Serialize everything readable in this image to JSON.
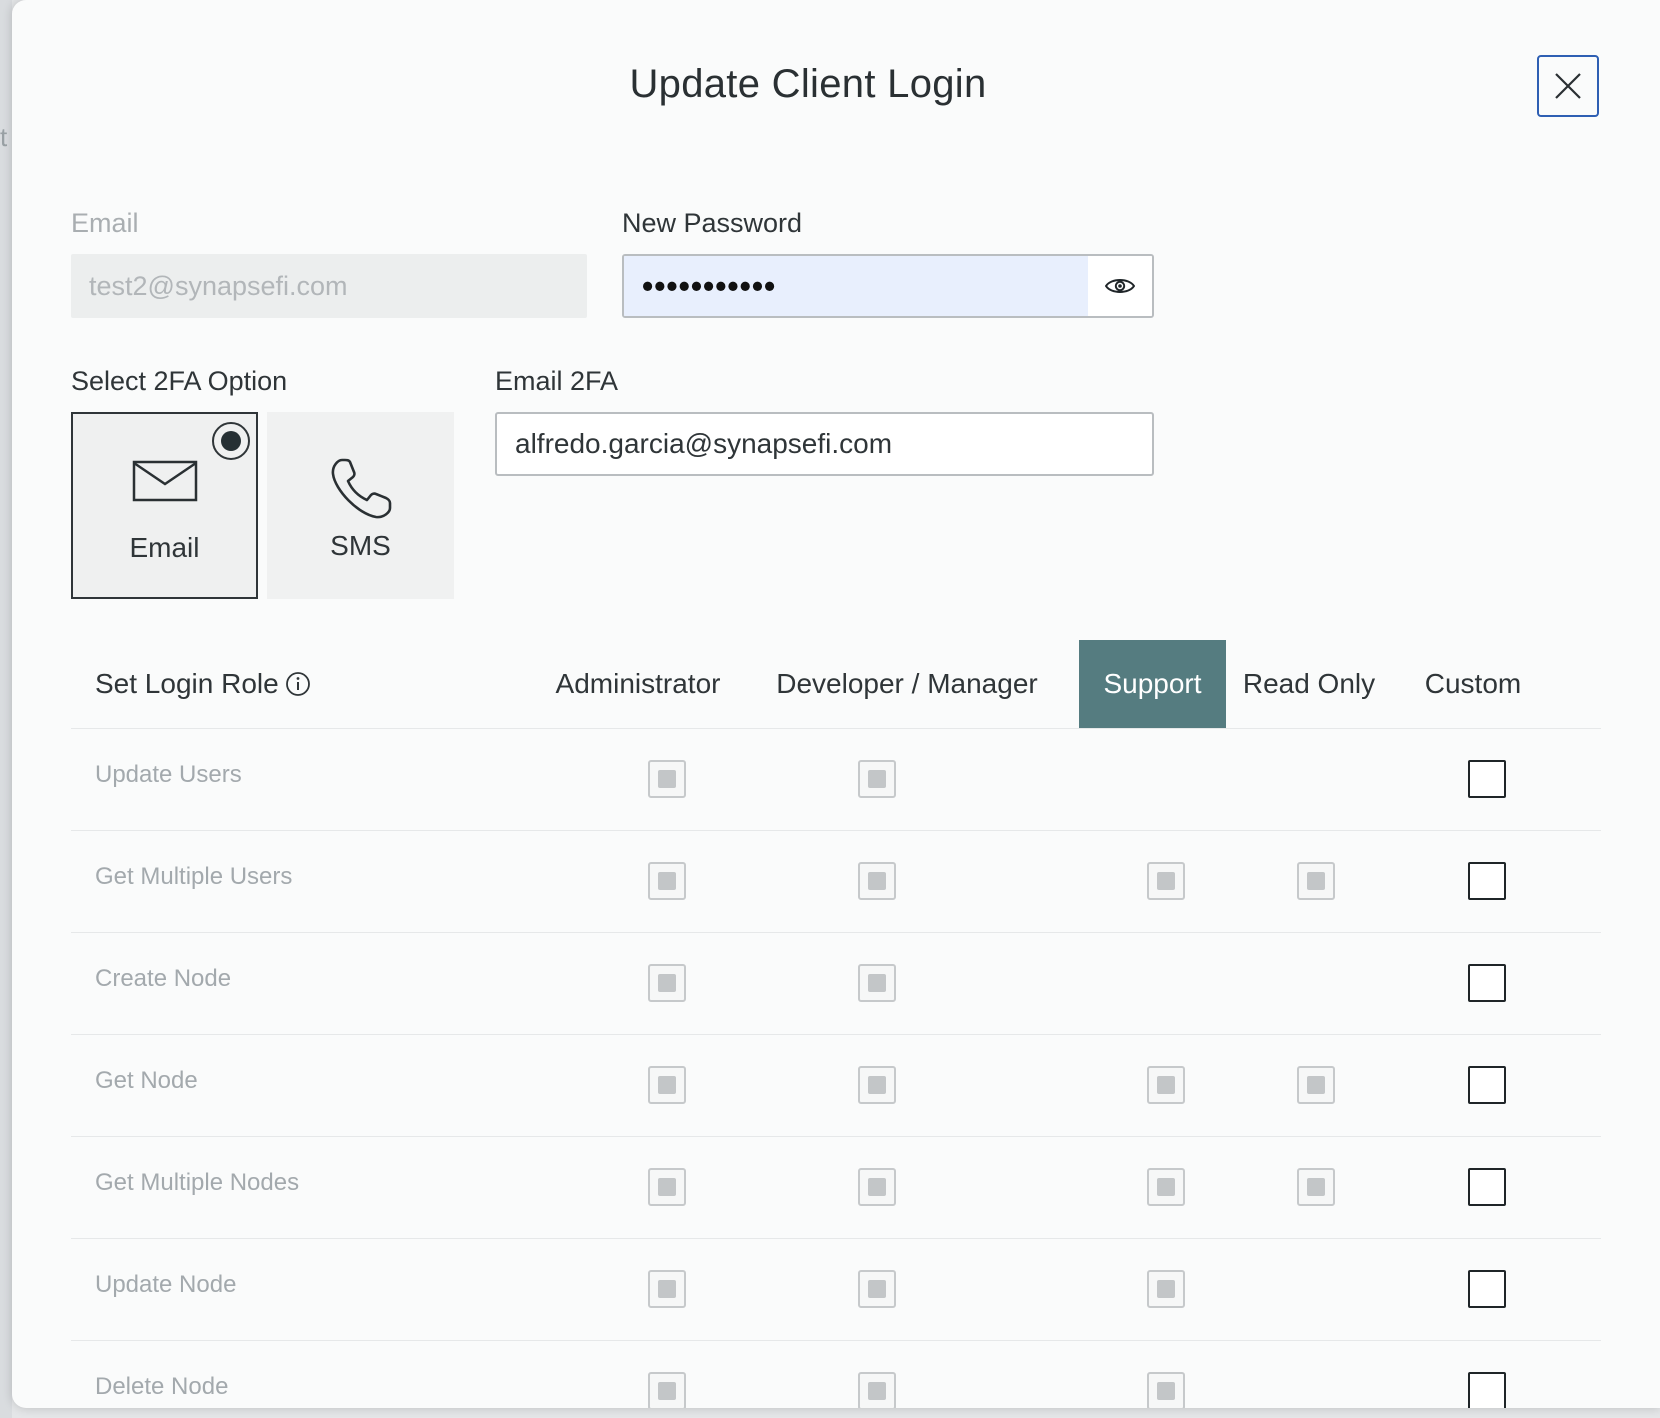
{
  "modal": {
    "title": "Update Client Login"
  },
  "form": {
    "email_label": "Email",
    "email_value": "test2@synapsefi.com",
    "password_label": "New Password",
    "password_masked": "•••••••••••",
    "twofa_label": "Select 2FA Option",
    "twofa_options": [
      {
        "label": "Email",
        "icon": "envelope-icon",
        "selected": true
      },
      {
        "label": "SMS",
        "icon": "phone-icon",
        "selected": false
      }
    ],
    "email2fa_label": "Email 2FA",
    "email2fa_value": "alfredo.garcia@synapsefi.com"
  },
  "roles": {
    "header_label": "Set Login Role",
    "columns": [
      "Administrator",
      "Developer / Manager",
      "Support",
      "Read Only",
      "Custom"
    ],
    "active_column": "Support",
    "permissions": [
      {
        "label": "Update Users",
        "checks": [
          true,
          true,
          false,
          false,
          false
        ]
      },
      {
        "label": "Get Multiple Users",
        "checks": [
          true,
          true,
          true,
          true,
          false
        ]
      },
      {
        "label": "Create Node",
        "checks": [
          true,
          true,
          false,
          false,
          false
        ]
      },
      {
        "label": "Get Node",
        "checks": [
          true,
          true,
          true,
          true,
          false
        ]
      },
      {
        "label": "Get Multiple Nodes",
        "checks": [
          true,
          true,
          true,
          true,
          false
        ]
      },
      {
        "label": "Update Node",
        "checks": [
          true,
          true,
          true,
          false,
          false
        ]
      },
      {
        "label": "Delete Node",
        "checks": [
          true,
          true,
          true,
          false,
          false
        ]
      }
    ]
  },
  "colors": {
    "active_tab": "#557c80",
    "close_border": "#2e5fb3",
    "password_bg": "#e8effd"
  }
}
